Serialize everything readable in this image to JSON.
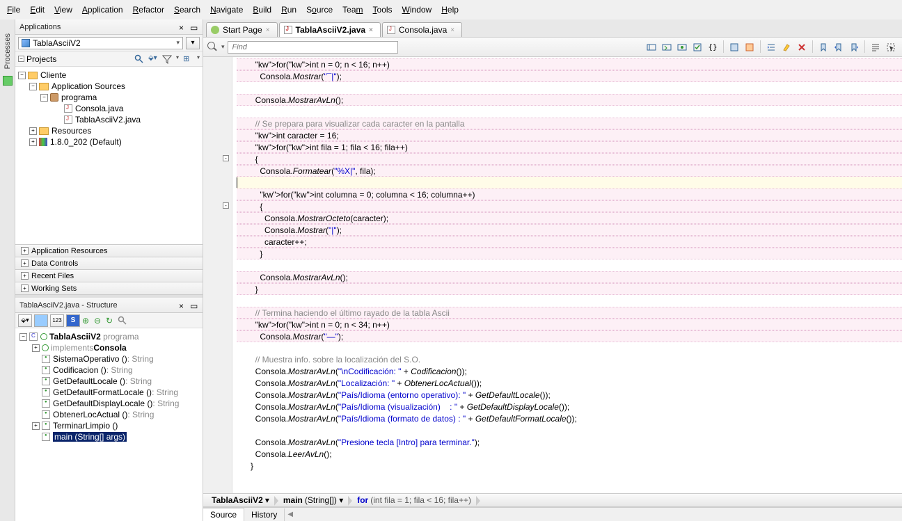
{
  "menu": [
    "File",
    "Edit",
    "View",
    "Application",
    "Refactor",
    "Search",
    "Navigate",
    "Build",
    "Run",
    "Source",
    "Team",
    "Tools",
    "Window",
    "Help"
  ],
  "leftRail": {
    "label": "Processes"
  },
  "applications": {
    "title": "Applications",
    "project_selected": "TablaAsciiV2",
    "projects_label": "Projects",
    "tree": {
      "root": "Cliente",
      "app_sources": "Application Sources",
      "package": "programa",
      "file1": "Consola.java",
      "file2": "TablaAsciiV2.java",
      "resources": "Resources",
      "jdk": "1.8.0_202 (Default)"
    },
    "panels": [
      "Application Resources",
      "Data Controls",
      "Recent Files",
      "Working Sets"
    ]
  },
  "structure": {
    "title": "TablaAsciiV2.java - Structure",
    "root": "TablaAsciiV2",
    "root_pkg": "programa",
    "implements": "implements",
    "implements_name": "Consola",
    "methods": [
      {
        "name": "SistemaOperativo ()",
        "ret": "String"
      },
      {
        "name": "Codificacion ()",
        "ret": "String"
      },
      {
        "name": "GetDefaultLocale ()",
        "ret": "String"
      },
      {
        "name": "GetDefaultFormatLocale ()",
        "ret": "String"
      },
      {
        "name": "GetDefaultDisplayLocale ()",
        "ret": "String"
      },
      {
        "name": "ObtenerLocActual ()",
        "ret": "String"
      },
      {
        "name": "TerminarLimpio ()",
        "ret": ""
      },
      {
        "name": "main (String[] args)",
        "ret": "",
        "selected": true
      }
    ]
  },
  "tabs": [
    {
      "label": "Start Page",
      "icon": "start"
    },
    {
      "label": "TablaAsciiV2.java",
      "icon": "java",
      "active": true
    },
    {
      "label": "Consola.java",
      "icon": "java"
    }
  ],
  "find_placeholder": "Find",
  "breadcrumb": [
    {
      "text": "TablaAsciiV2",
      "bold": true
    },
    {
      "text": "main(String[])",
      "bold": false,
      "method": true
    },
    {
      "text": "for(int fila = 1; fila < 16; fila++)",
      "for": true
    }
  ],
  "source_history": {
    "source": "Source",
    "history": "History"
  },
  "code": [
    {
      "t": "        for(int n = 0; n < 16; n++)",
      "hl": 1
    },
    {
      "t": "          Consola.Mostrar(\"¯|\");",
      "hl": 1
    },
    {
      "t": "",
      "hl": 0
    },
    {
      "t": "        Consola.MostrarAvLn();",
      "hl": 1
    },
    {
      "t": "",
      "hl": 0
    },
    {
      "t": "        // Se prepara para visualizar cada caracter en la pantalla",
      "hl": 1,
      "cmt": 1
    },
    {
      "t": "        int caracter = 16;",
      "hl": 1
    },
    {
      "t": "        for(int fila = 1; fila < 16; fila++)",
      "hl": 1
    },
    {
      "t": "        {",
      "hl": 1,
      "fold": "-"
    },
    {
      "t": "          Consola.Formatear(\"%X|\", fila);",
      "hl": 1
    },
    {
      "t": "",
      "hl": 0,
      "cur": 1
    },
    {
      "t": "          for(int columna = 0; columna < 16; columna++)",
      "hl": 1
    },
    {
      "t": "          {",
      "hl": 1,
      "fold": "-"
    },
    {
      "t": "            Consola.MostrarOcteto(caracter);",
      "hl": 1
    },
    {
      "t": "            Consola.Mostrar(\"|\");",
      "hl": 1
    },
    {
      "t": "            caracter++;",
      "hl": 1
    },
    {
      "t": "          }",
      "hl": 1
    },
    {
      "t": "",
      "hl": 0
    },
    {
      "t": "          Consola.MostrarAvLn();",
      "hl": 1
    },
    {
      "t": "        }",
      "hl": 1
    },
    {
      "t": "",
      "hl": 0
    },
    {
      "t": "        // Termina haciendo el último rayado de la tabla Ascii",
      "hl": 1,
      "cmt": 1
    },
    {
      "t": "        for(int n = 0; n < 34; n++)",
      "hl": 1
    },
    {
      "t": "          Consola.Mostrar(\"—\");",
      "hl": 1
    },
    {
      "t": "",
      "hl": 0
    },
    {
      "t": "        // Muestra info. sobre la localización del S.O.",
      "hl": 0,
      "cmt": 1
    },
    {
      "t": "        Consola.MostrarAvLn(\"\\nCodificación: \" + Codificacion());",
      "hl": 0
    },
    {
      "t": "        Consola.MostrarAvLn(\"Localización: \" + ObtenerLocActual());",
      "hl": 0
    },
    {
      "t": "        Consola.MostrarAvLn(\"País/Idioma (entorno operativo): \" + GetDefaultLocale());",
      "hl": 0
    },
    {
      "t": "        Consola.MostrarAvLn(\"País/Idioma (visualización)    : \" + GetDefaultDisplayLocale());",
      "hl": 0
    },
    {
      "t": "        Consola.MostrarAvLn(\"País/Idioma (formato de datos) : \" + GetDefaultFormatLocale());",
      "hl": 0
    },
    {
      "t": "",
      "hl": 0
    },
    {
      "t": "        Consola.MostrarAvLn(\"Presione tecla [Intro] para terminar.\");",
      "hl": 0
    },
    {
      "t": "        Consola.LeerAvLn();",
      "hl": 0
    },
    {
      "t": "      }",
      "hl": 0
    },
    {
      "t": "",
      "hl": 0
    }
  ]
}
